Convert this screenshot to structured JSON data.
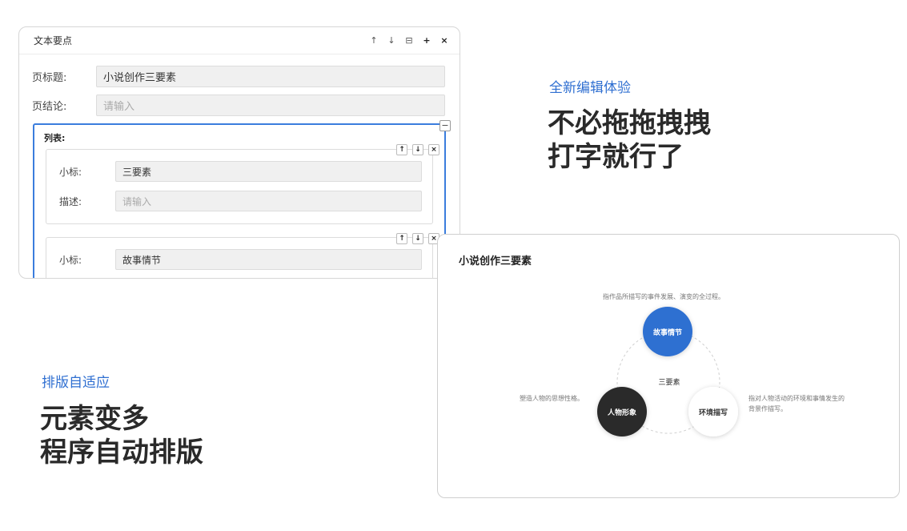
{
  "editor": {
    "header_title": "文本要点",
    "header_icons": [
      "arrow-up-icon",
      "arrow-down-icon",
      "collapse-square-icon",
      "plus-icon",
      "close-icon"
    ],
    "fields": {
      "page_title_label": "页标题:",
      "page_title_value": "小说创作三要素",
      "page_conclusion_label": "页结论:",
      "page_conclusion_placeholder": "请输入"
    },
    "list": {
      "label": "列表:",
      "items": [
        {
          "subtitle_label": "小标:",
          "subtitle_value": "三要素",
          "desc_label": "描述:",
          "desc_placeholder": "请输入"
        },
        {
          "subtitle_label": "小标:",
          "subtitle_value": "故事情节"
        }
      ]
    },
    "item_controls": [
      "↑",
      "↓",
      "×"
    ]
  },
  "features": [
    {
      "tag": "全新编辑体验",
      "headline_line1": "不必拖拖拽拽",
      "headline_line2": "打字就行了"
    },
    {
      "tag": "排版自适应",
      "headline_line1": "元素变多",
      "headline_line2": "程序自动排版"
    }
  ],
  "diagram": {
    "title": "小说创作三要素",
    "center_label": "三要素",
    "nodes": [
      {
        "label": "故事情节",
        "description": "指作品所描写的事件发展、演变的全过程。",
        "color": "#2f6fd1"
      },
      {
        "label": "人物形象",
        "description": "塑造人物的思想性格。",
        "color": "#2b2b2b"
      },
      {
        "label": "环境描写",
        "description_line1": "指对人物活动的环境和事情发生的",
        "description_line2": "背景作描写。",
        "color": "#ffffff"
      }
    ]
  },
  "colors": {
    "accent": "#2f6fd1",
    "headline": "#2a2a2a",
    "border": "#d6d6d6"
  }
}
